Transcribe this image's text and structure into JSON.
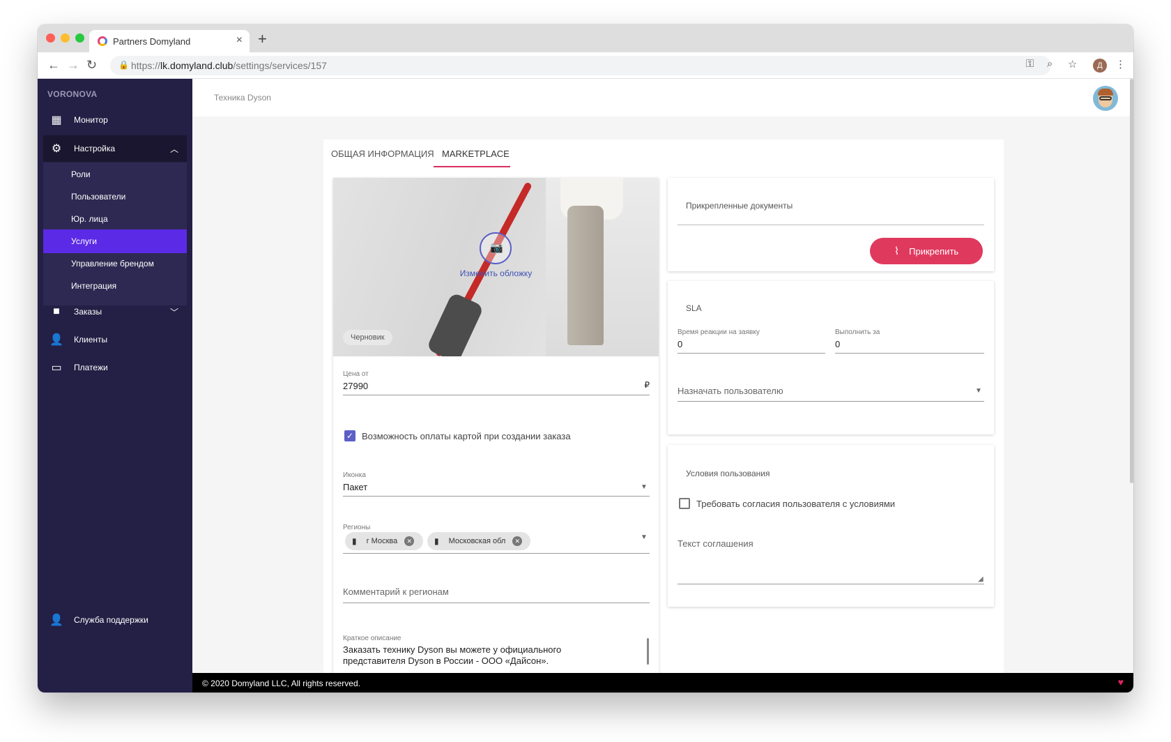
{
  "browser": {
    "tab_title": "Partners Domyland",
    "tab_close": "×",
    "new_tab": "+",
    "url_prefix": "https://",
    "url_host": "lk.domyland.club",
    "url_path": "/settings/services/157",
    "profile_initial": "Д",
    "lights": {
      "red": "#ff5f57",
      "yellow": "#febc2e",
      "green": "#28c840"
    }
  },
  "sidebar": {
    "org": "VORONOVA",
    "monitor": "Монитор",
    "settings": "Настройка",
    "submenu": [
      "Роли",
      "Пользователи",
      "Юр. лица",
      "Услуги",
      "Управление брендом",
      "Интеграция"
    ],
    "orders": "Заказы",
    "clients": "Клиенты",
    "payments": "Платежи",
    "support": "Служба поддержки",
    "bg": "#241f45",
    "active_color": "#5b2ae6"
  },
  "header": {
    "title": "Техника Dyson"
  },
  "tabs": {
    "general": "ОБЩАЯ ИНФОРМАЦИЯ",
    "marketplace": "MARKETPLACE"
  },
  "left": {
    "change_cover": "Изменить обложку",
    "draft": "Черновик",
    "price_label": "Цена от",
    "price_value": "27990",
    "currency": "₽",
    "card_payment": "Возможность оплаты картой при создании заказа",
    "icon_label": "Иконка",
    "icon_value": "Пакет",
    "regions_label": "Регионы",
    "regions": [
      "г Москва",
      "Московская обл"
    ],
    "regions_comment": "Комментарий к регионам",
    "desc_label": "Краткое описание",
    "desc_line1": "Заказать технику Dyson вы можете у официального",
    "desc_line2": "представителя Dyson в России - ООО «Дайсон»."
  },
  "documents": {
    "title": "Прикрепленные документы",
    "attach": "Прикрепить"
  },
  "sla": {
    "title": "SLA",
    "reaction_label": "Время реакции на заявку",
    "reaction_value": "0",
    "complete_label": "Выполнить за",
    "complete_value": "0",
    "assign": "Назначать пользователю"
  },
  "terms": {
    "title": "Условия пользования",
    "require_consent": "Требовать согласия пользователя с условиями",
    "agreement_text": "Текст соглашения"
  },
  "footer": {
    "copyright": "© 2020 Domyland LLC, All rights reserved.",
    "heart": "♥"
  },
  "colors": {
    "accent": "#d9305f",
    "button": "#e0395e",
    "link": "#3f51b5",
    "checkbox": "#5b5fc7"
  }
}
